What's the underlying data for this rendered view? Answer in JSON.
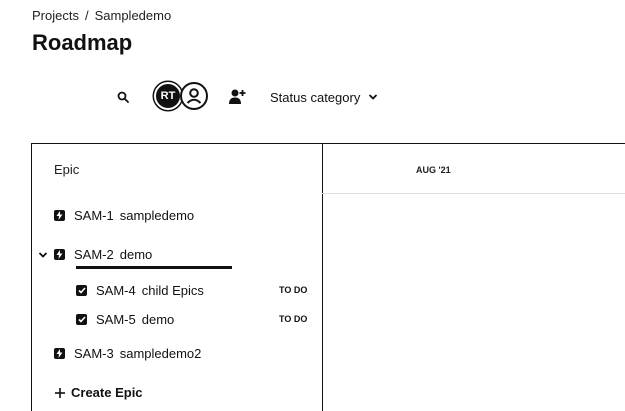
{
  "breadcrumb": {
    "project_link": "Projects",
    "separator": "/",
    "current": "Sampledemo"
  },
  "page_title": "Roadmap",
  "toolbar": {
    "search_icon": "search-icon",
    "avatars": [
      {
        "initials": "RT"
      },
      {
        "icon": "user-icon"
      }
    ],
    "add_people_icon": "add-person-icon",
    "status_dropdown_label": "Status category"
  },
  "table": {
    "epic_header": "Epic",
    "timeline_month": "AUG '21",
    "rows": [
      {
        "key": "SAM-1",
        "summary": "sampledemo",
        "type": "epic",
        "expanded": false
      },
      {
        "key": "SAM-2",
        "summary": "demo",
        "type": "epic",
        "expanded": true
      },
      {
        "key": "SAM-4",
        "summary": "child Epics",
        "type": "task",
        "status": "TO DO"
      },
      {
        "key": "SAM-5",
        "summary": "demo",
        "type": "task",
        "status": "TO DO"
      },
      {
        "key": "SAM-3",
        "summary": "sampledemo2",
        "type": "epic",
        "expanded": false
      }
    ],
    "create_epic_label": "Create Epic"
  }
}
